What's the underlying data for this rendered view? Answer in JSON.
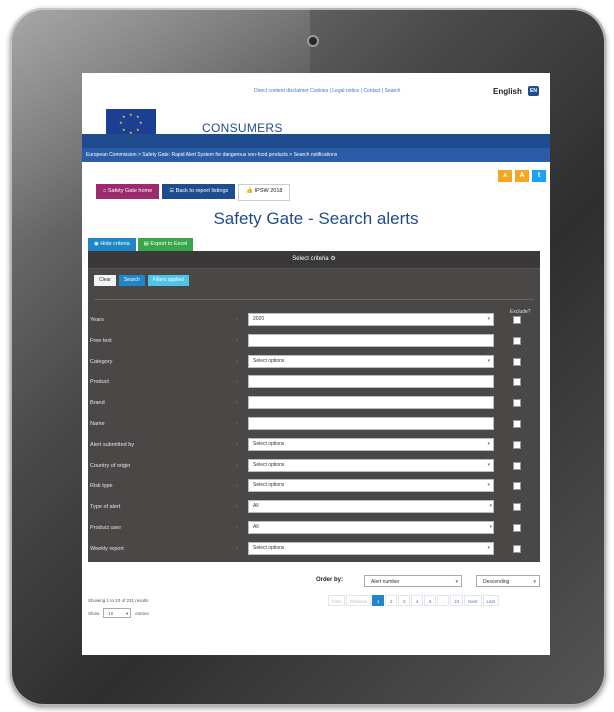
{
  "header": {
    "top_links": "Direct content disclaimer  Cookies | Legal notice | Contact | Search",
    "language": "English",
    "language_code": "EN",
    "logo_text": "European Commission",
    "site_title": "CONSUMERS",
    "breadcrumb": "European Commission > Safety Gate: Rapid Alert System for dangerous non-food products > Search notifications"
  },
  "tools": {
    "a_small": "A",
    "a_large": "A",
    "twitter": "t"
  },
  "nav": {
    "home": "Safety Gate home",
    "back": "Back to report listings",
    "ipsw": "IPSW 2018"
  },
  "page_title": "Safety Gate - Search alerts",
  "criteria_tabs": {
    "hide": "Hide criteria",
    "excel": "Export to Excel"
  },
  "panel": {
    "title": "Select criteria",
    "buttons": {
      "clear": "Clear",
      "search": "Search",
      "filters": "Filters applied"
    },
    "exclude_label": "Exclude?",
    "rows": [
      {
        "label": "Years",
        "value": "2020"
      },
      {
        "label": "Free text",
        "value": ""
      },
      {
        "label": "Category",
        "value": "Select options"
      },
      {
        "label": "Product",
        "value": ""
      },
      {
        "label": "Brand",
        "value": ""
      },
      {
        "label": "Name",
        "value": ""
      },
      {
        "label": "Alert submitted by",
        "value": "Select options"
      },
      {
        "label": "Country of origin",
        "value": "Select options"
      },
      {
        "label": "Risk type",
        "value": "Select options"
      },
      {
        "label": "Type of alert",
        "value": "All"
      },
      {
        "label": "Product user",
        "value": "All"
      },
      {
        "label": "Weekly report",
        "value": "Select options"
      }
    ]
  },
  "results": {
    "order_by_label": "Order by:",
    "order_by_value": "Alert number",
    "order_dir_value": "Descending",
    "showing": "Showing 1 to 10 of 231 results",
    "show_label": "Show",
    "show_value": "10",
    "entries_label": "entries",
    "pager": {
      "first": "First",
      "previous": "Previous",
      "pages": [
        "1",
        "2",
        "3",
        "4",
        "5"
      ],
      "ellipsis": "...",
      "last_page": "24",
      "next": "Next",
      "last": "Last"
    }
  }
}
